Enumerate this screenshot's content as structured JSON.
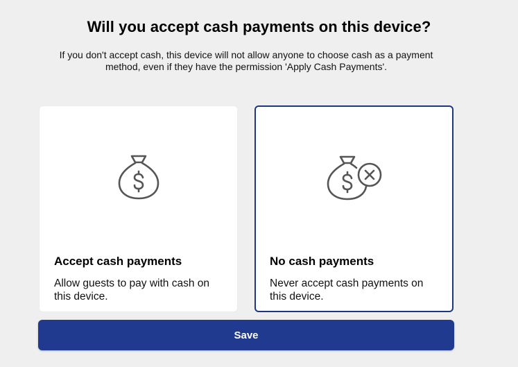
{
  "header": {
    "title": "Will you accept cash payments on this device?",
    "subtitle": "If you don't accept cash, this device will not allow anyone to choose cash as a payment method, even if they have the permission 'Apply Cash Payments'."
  },
  "options": [
    {
      "title": "Accept cash payments",
      "description": "Allow guests to pay with cash on this device.",
      "icon": "money-bag-icon",
      "selected": false
    },
    {
      "title": "No cash payments",
      "description": "Never accept cash payments on this device.",
      "icon": "money-bag-x-icon",
      "selected": true
    }
  ],
  "actions": {
    "save_label": "Save"
  },
  "colors": {
    "accent": "#1f3a8e",
    "selected_border": "#1d3680",
    "background": "#efefef",
    "card": "#ffffff",
    "icon_stroke": "#555555"
  }
}
